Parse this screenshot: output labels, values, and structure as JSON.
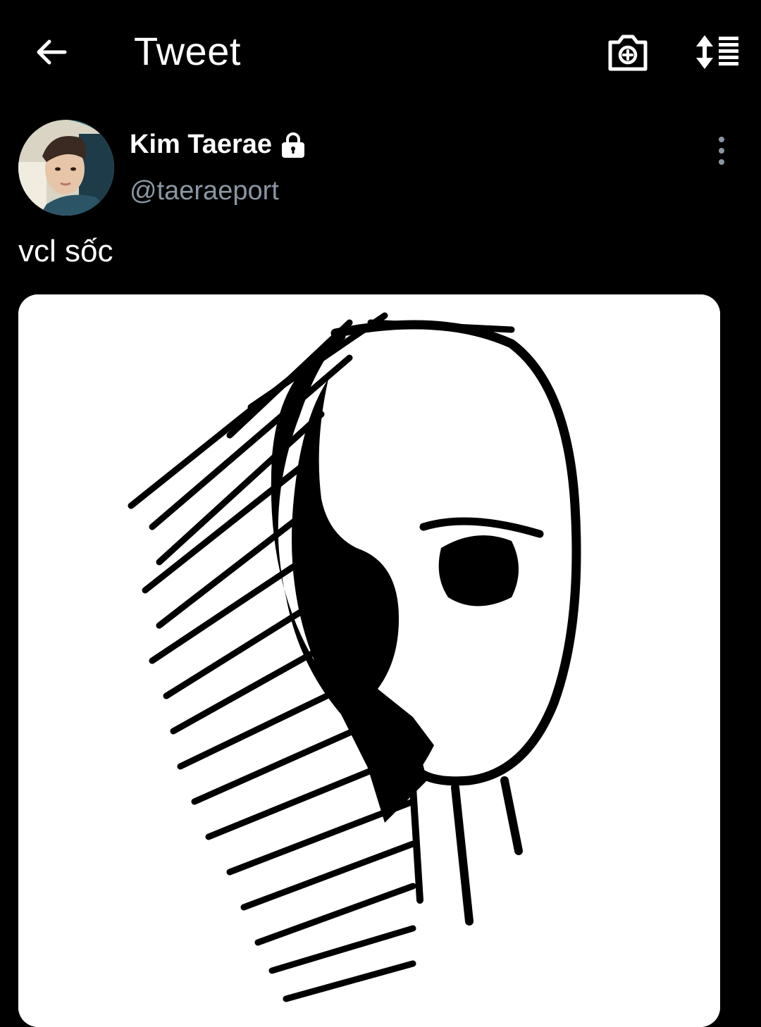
{
  "header": {
    "title": "Tweet",
    "icons": [
      "back-arrow-icon",
      "camera-plus-icon",
      "sort-list-icon"
    ]
  },
  "tweet": {
    "author": {
      "display_name": "Kim Taerae",
      "handle": "@taeraeport",
      "protected": true,
      "avatar": "profile-photo"
    },
    "text": "vcl sốc",
    "media": {
      "type": "image",
      "description_icon": "ink-drawn-face-sketch"
    }
  },
  "colors": {
    "background": "#000000",
    "text": "#ffffff",
    "handle": "#8b96a3",
    "media_bg": "#ffffff"
  }
}
